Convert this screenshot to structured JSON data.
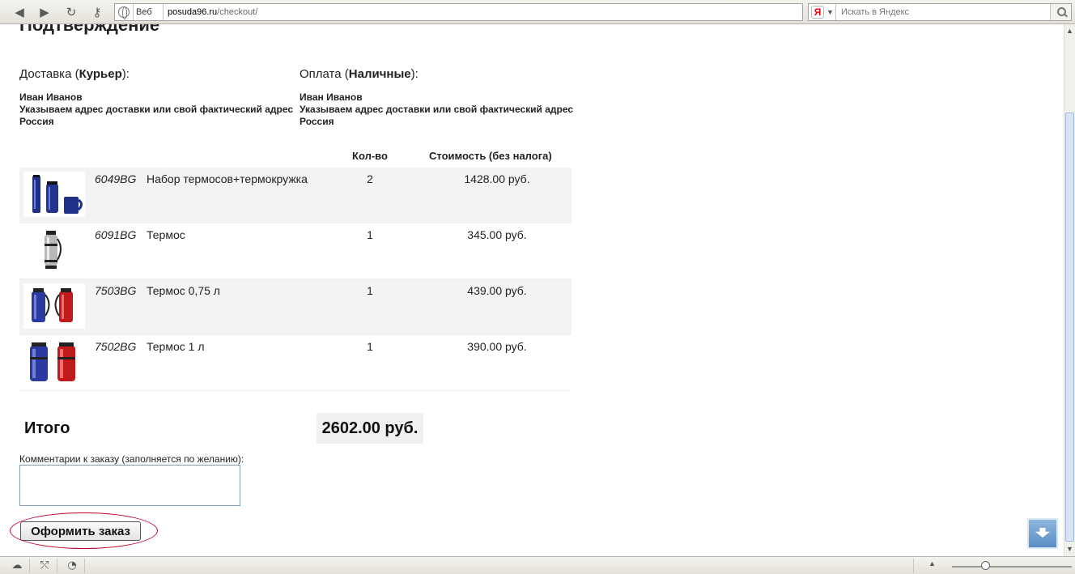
{
  "browser": {
    "mode_label": "Веб",
    "url_host": "posuda96.ru",
    "url_path": "/checkout/",
    "search_logo": "Я",
    "search_placeholder": "Искать в Яндекс"
  },
  "page": {
    "heading": "Подтверждение",
    "delivery": {
      "prefix": "Доставка (",
      "method": "Курьер",
      "suffix": "):",
      "name": "Иван Иванов",
      "address": "Указываем адрес доставки или свой фактический адрес",
      "country": "Россия"
    },
    "payment": {
      "prefix": "Оплата (",
      "method": "Наличные",
      "suffix": "):",
      "name": "Иван Иванов",
      "address": "Указываем адрес доставки или свой фактический адрес",
      "country": "Россия"
    },
    "table": {
      "qty_header": "Кол-во",
      "cost_header": "Стоимость (без налога)",
      "rows": [
        {
          "sku": "6049BG",
          "name": "Набор термосов+термокружка",
          "qty": "2",
          "price": "1428.00 руб."
        },
        {
          "sku": "6091BG",
          "name": "Термос",
          "qty": "1",
          "price": "345.00 руб."
        },
        {
          "sku": "7503BG",
          "name": "Термос 0,75 л",
          "qty": "1",
          "price": "439.00 руб."
        },
        {
          "sku": "7502BG",
          "name": "Термос 1 л",
          "qty": "1",
          "price": "390.00 руб."
        }
      ]
    },
    "total_label": "Итого",
    "total_value": "2602.00 руб.",
    "comment_label": "Комментарии к заказу (заполняется по желанию):",
    "comment_value": "",
    "order_button": "Оформить заказ"
  },
  "colors": {
    "highlight_ring": "#c0002a",
    "row_alt_bg": "#f3f3f3"
  }
}
